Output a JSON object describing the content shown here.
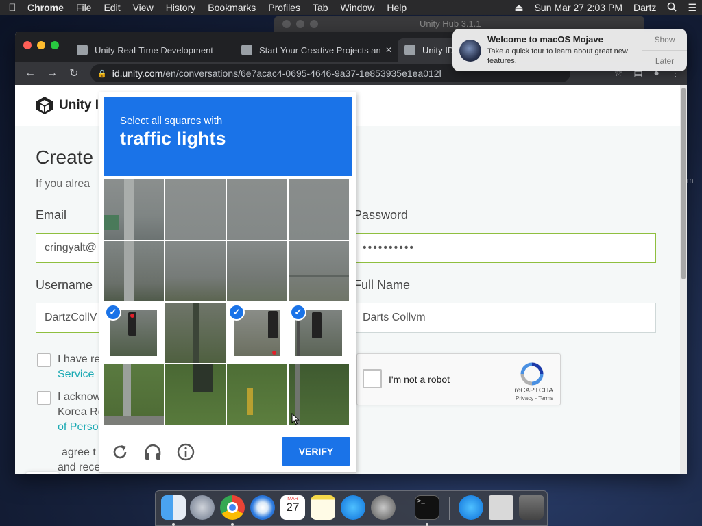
{
  "menubar": {
    "app": "Chrome",
    "items": [
      "File",
      "Edit",
      "View",
      "History",
      "Bookmarks",
      "Profiles",
      "Tab",
      "Window",
      "Help"
    ],
    "datetime": "Sun Mar 27  2:03 PM",
    "user": "Dartz"
  },
  "hub_window": {
    "title": "Unity Hub 3.1.1"
  },
  "browser": {
    "tabs": [
      {
        "label": "Unity Real-Time Development"
      },
      {
        "label": "Start Your Creative Projects an"
      },
      {
        "label": "Unity ID"
      }
    ],
    "url_host": "id.unity.com",
    "url_path": "/en/conversations/6e7acac4-0695-4646-9a37-1e853935e1ea012l"
  },
  "page": {
    "logo_text": "Unity I",
    "heading": "Create",
    "subheading": "If you alrea",
    "email_label": "Email",
    "email_value": "cringyalt@",
    "password_label": "Password",
    "password_value": "••••••••••",
    "username_label": "Username",
    "username_value": "DartzCollV",
    "fullname_label": "Full Name",
    "fullname_value": "Darts Collvm",
    "agree1_a": "I have re",
    "agree1_b": "Service",
    "agree2_a": "I acknow",
    "agree2_b": "Korea Re",
    "agree2_c": "of Perso",
    "agree3_a": "agree t",
    "agree3_b": "and rece"
  },
  "recaptcha_widget": {
    "label": "I'm not a robot",
    "brand": "reCAPTCHA",
    "terms": "Privacy - Terms"
  },
  "captcha": {
    "instruction": "Select all squares with",
    "target": "traffic lights",
    "verify_label": "VERIFY",
    "selected_tiles": [
      8,
      10,
      11
    ]
  },
  "notification": {
    "title": "Welcome to macOS Mojave",
    "body": "Take a quick tour to learn about great new features.",
    "show_label": "Show",
    "later_label": "Later"
  },
  "dock": {
    "calendar_month": "MAR",
    "calendar_day": "27"
  },
  "edge_text": "m"
}
